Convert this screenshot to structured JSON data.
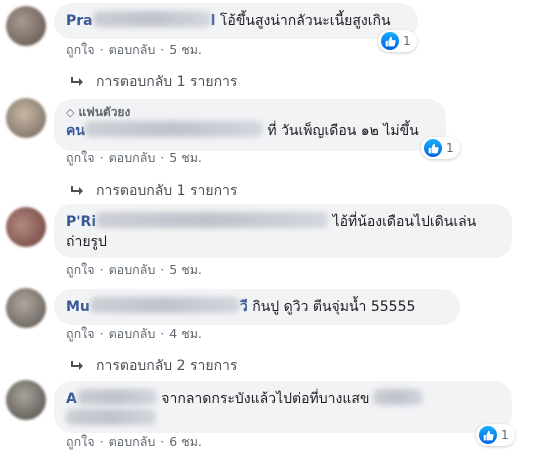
{
  "comments": [
    {
      "name_visible": "Pra",
      "name_suffix": "l",
      "text": "โอ้ขึ้นสูงน่ากลัวนะเนี้ยสูงเกิน",
      "likes": "1",
      "like_label": "ถูกใจ",
      "reply_label": "ตอบกลับ",
      "time": "5 ชม.",
      "replies": "การตอบกลับ 1 รายการ"
    },
    {
      "badge": "แฟนตัวยง",
      "name_visible": "คน",
      "text": "ที่ วันเพ็ญเดือน ๑๒ ไม่ขึ้น",
      "likes": "1",
      "like_label": "ถูกใจ",
      "reply_label": "ตอบกลับ",
      "time": "5 ชม.",
      "replies": "การตอบกลับ 1 รายการ"
    },
    {
      "name_visible": "P'Ri",
      "text_line1": "ไอ้ที่น้องเดือนไปเดินเล่น",
      "text_line2": "ถ่ายรูป",
      "like_label": "ถูกใจ",
      "reply_label": "ตอบกลับ",
      "time": "5 ชม."
    },
    {
      "name_visible": "Mu",
      "name_suffix": "วี",
      "text": "กินปู ดูวิว ตีนจุ่มน้ำ 55555",
      "like_label": "ถูกใจ",
      "reply_label": "ตอบกลับ",
      "time": "4 ชม.",
      "replies": "การตอบกลับ 2 รายการ"
    },
    {
      "name_visible": "A",
      "text": "จากลาดกระบังแล้วไปต่อที่บางแสข",
      "likes": "1",
      "like_label": "ถูกใจ",
      "reply_label": "ตอบกลับ",
      "time": "6 ชม."
    }
  ]
}
